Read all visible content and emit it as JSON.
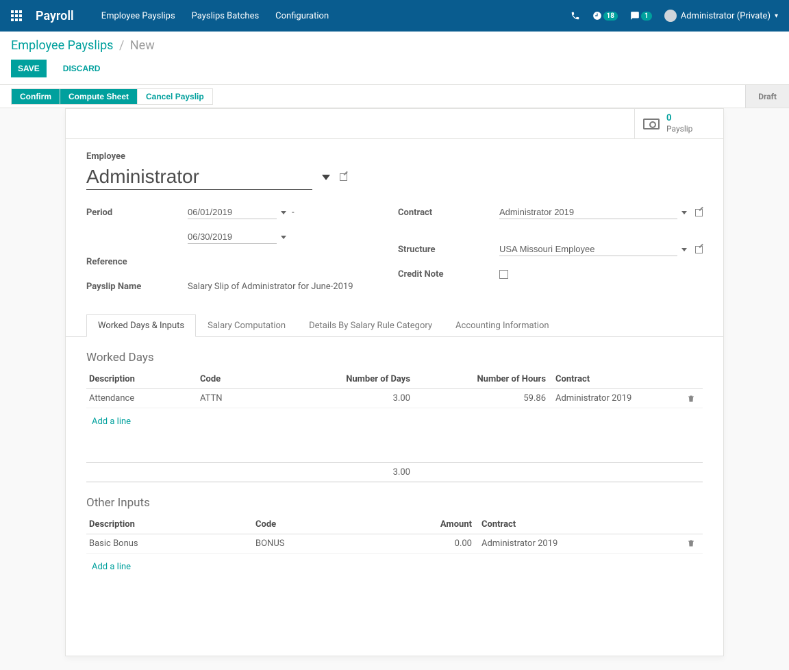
{
  "navbar": {
    "brand": "Payroll",
    "menu": [
      "Employee Payslips",
      "Payslips Batches",
      "Configuration"
    ],
    "activities_badge": "18",
    "messages_badge": "1",
    "username": "Administrator (Private)"
  },
  "breadcrumb": {
    "link": "Employee Payslips",
    "current": "New"
  },
  "controlPanel": {
    "save": "Save",
    "discard": "Discard"
  },
  "statusbar": {
    "confirm": "Confirm",
    "compute": "Compute Sheet",
    "cancel": "Cancel Payslip",
    "status": "Draft"
  },
  "statButton": {
    "value": "0",
    "label": "Payslip"
  },
  "form": {
    "employee_label": "Employee",
    "employee": "Administrator",
    "period_label": "Period",
    "period_from": "06/01/2019",
    "period_to": "06/30/2019",
    "reference_label": "Reference",
    "reference": "",
    "payslip_name_label": "Payslip Name",
    "payslip_name": "Salary Slip of Administrator for June-2019",
    "contract_label": "Contract",
    "contract": "Administrator 2019",
    "structure_label": "Structure",
    "structure": "USA Missouri Employee",
    "credit_note_label": "Credit Note"
  },
  "tabs": [
    "Worked Days & Inputs",
    "Salary Computation",
    "Details By Salary Rule Category",
    "Accounting Information"
  ],
  "workedDays": {
    "title": "Worked Days",
    "headers": {
      "desc": "Description",
      "code": "Code",
      "days": "Number of Days",
      "hours": "Number of Hours",
      "contract": "Contract"
    },
    "rows": [
      {
        "desc": "Attendance",
        "code": "ATTN",
        "days": "3.00",
        "hours": "59.86",
        "contract": "Administrator 2019"
      }
    ],
    "add": "Add a line",
    "total_days": "3.00"
  },
  "otherInputs": {
    "title": "Other Inputs",
    "headers": {
      "desc": "Description",
      "code": "Code",
      "amount": "Amount",
      "contract": "Contract"
    },
    "rows": [
      {
        "desc": "Basic Bonus",
        "code": "BONUS",
        "amount": "0.00",
        "contract": "Administrator 2019"
      }
    ],
    "add": "Add a line"
  }
}
